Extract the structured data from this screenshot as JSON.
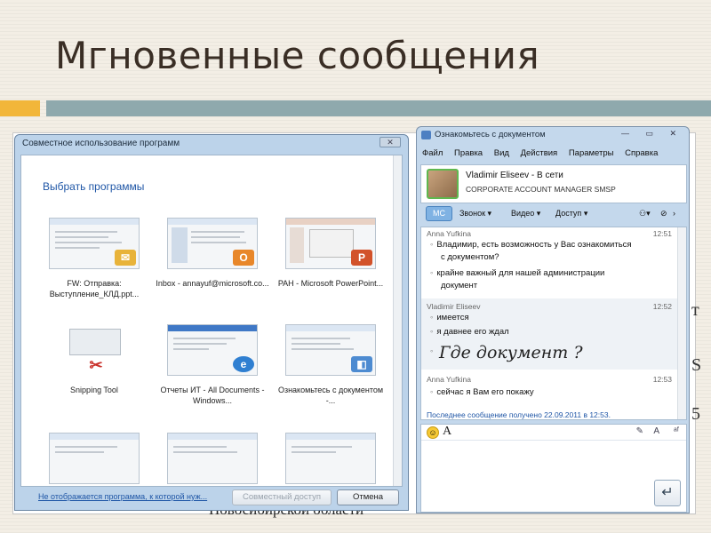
{
  "slide": {
    "title": "Мгновенные сообщения",
    "background_text": "Новосибирской области",
    "accent_colors": [
      "#f2b63a",
      "#8fa9ad"
    ]
  },
  "share_dialog": {
    "title": "Совместное использование программ",
    "close_label": "✕",
    "heading": "Выбрать программы",
    "programs": [
      {
        "label": "FW: Отправка: Выступление_КЛД.ppt...",
        "icon": "outlook-envelope-icon",
        "badge": "✉",
        "color": "#e8b33a"
      },
      {
        "label": "Inbox - annayuf@microsoft.co...",
        "icon": "outlook-icon",
        "badge": "O",
        "color": "#e8872a"
      },
      {
        "label": "PAH - Microsoft PowerPoint...",
        "icon": "powerpoint-icon",
        "badge": "P",
        "color": "#d2522a"
      },
      {
        "label": "Snipping Tool",
        "icon": "scissors-icon",
        "badge": "✂",
        "color": "#c9312b"
      },
      {
        "label": "Отчеты ИТ - All Documents - Windows...",
        "icon": "internet-explorer-icon",
        "badge": "e",
        "color": "#2f7fd1"
      },
      {
        "label": "Ознакомьтесь с документом -...",
        "icon": "communicator-icon",
        "badge": "◧",
        "color": "#4d8bd1"
      }
    ],
    "footer_link": "Не отображается программа, к которой нуж...",
    "share_button": "Совместный доступ",
    "cancel_button": "Отмена"
  },
  "im_window": {
    "title": "Ознакомьтесь с документом",
    "window_controls": "— ▭ ✕",
    "menu": [
      "Файл",
      "Правка",
      "Вид",
      "Действия",
      "Параметры",
      "Справка"
    ],
    "contact": {
      "name": "Vladimir Eliseev - В сети",
      "role": "CORPORATE ACCOUNT MANAGER SMSP"
    },
    "toolbar": {
      "tab": "МС",
      "call": "Звонок",
      "video": "Видео",
      "access": "Доступ"
    },
    "messages": [
      {
        "sender": "Anna Yufkina",
        "time": "12:51",
        "lines": [
          "Владимир, есть возможность у Вас ознакомиться",
          "с документом?",
          "крайне важный для нашей администрации",
          "документ"
        ]
      },
      {
        "sender": "Vladimir Eliseev",
        "time": "12:52",
        "lines": [
          "имеется",
          "я давнее его ждал"
        ],
        "handwriting": "Где документ ?"
      },
      {
        "sender": "Anna Yufkina",
        "time": "12:53",
        "lines": [
          "сейчас я Вам его покажу"
        ]
      }
    ],
    "status": "Последнее сообщение получено 22.09.2011 в 12:53.",
    "send_label": "↵"
  }
}
